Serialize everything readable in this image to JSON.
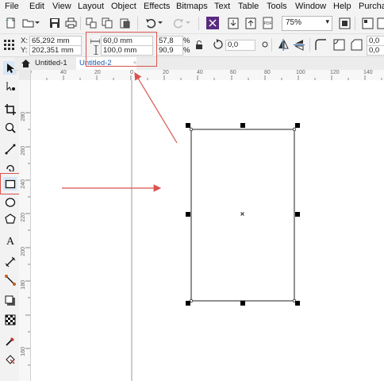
{
  "menu": {
    "items": [
      {
        "label": "File"
      },
      {
        "label": "Edit"
      },
      {
        "label": "View"
      },
      {
        "label": "Layout"
      },
      {
        "label": "Object"
      },
      {
        "label": "Effects"
      },
      {
        "label": "Bitmaps"
      },
      {
        "label": "Text"
      },
      {
        "label": "Table"
      },
      {
        "label": "Tools"
      },
      {
        "label": "Window"
      },
      {
        "label": "Help"
      },
      {
        "label": "Purchas"
      }
    ]
  },
  "toolbar": {
    "zoom_value": "75%",
    "icons": [
      "new-document-icon",
      "open-icon",
      "save-icon",
      "print-icon",
      "cut-icon",
      "copy-icon",
      "paste-icon",
      "undo-icon",
      "redo-icon",
      "corel-connect-icon",
      "import-icon",
      "export-icon",
      "publish-pdf-icon",
      "zoom-level-select",
      "full-screen-icon",
      "snap-icon"
    ]
  },
  "property_bar": {
    "x_label": "X:",
    "x_value": "65,292 mm",
    "y_label": "Y:",
    "y_value": "202,351 mm",
    "width_value": "60,0 mm",
    "height_value": "100,0 mm",
    "scale_x": "57,8",
    "scale_y": "90,9",
    "percent": "%",
    "rotation_value": "0,0",
    "corner_value_1": "0,0",
    "corner_value_2": "0,0"
  },
  "tabs": {
    "items": [
      {
        "label": "Untitled-1",
        "active": false
      },
      {
        "label": "Untitled-2",
        "active": true
      }
    ],
    "add_label": "+"
  },
  "ruler": {
    "h_labels": [
      "60",
      "40",
      "20",
      "0",
      "20",
      "40",
      "60",
      "80",
      "100",
      "120",
      "140"
    ],
    "v_labels": [
      "280",
      "260",
      "240",
      "220",
      "200",
      "180",
      "160"
    ]
  },
  "tools": [
    "pick-tool-icon",
    "shape-tool-icon",
    "crop-tool-icon",
    "zoom-tool-icon",
    "freehand-tool-icon",
    "artistic-media-icon",
    "rectangle-tool-icon",
    "ellipse-tool-icon",
    "polygon-tool-icon",
    "text-tool-icon",
    "parallel-dimension-icon",
    "connector-tool-icon",
    "drop-shadow-icon",
    "transparency-icon",
    "eyedropper-icon",
    "interactive-fill-icon"
  ],
  "colors": {
    "annotation": "#d9534f",
    "selection_handle": "#000000",
    "tab_active_text": "#1a5fb4"
  }
}
